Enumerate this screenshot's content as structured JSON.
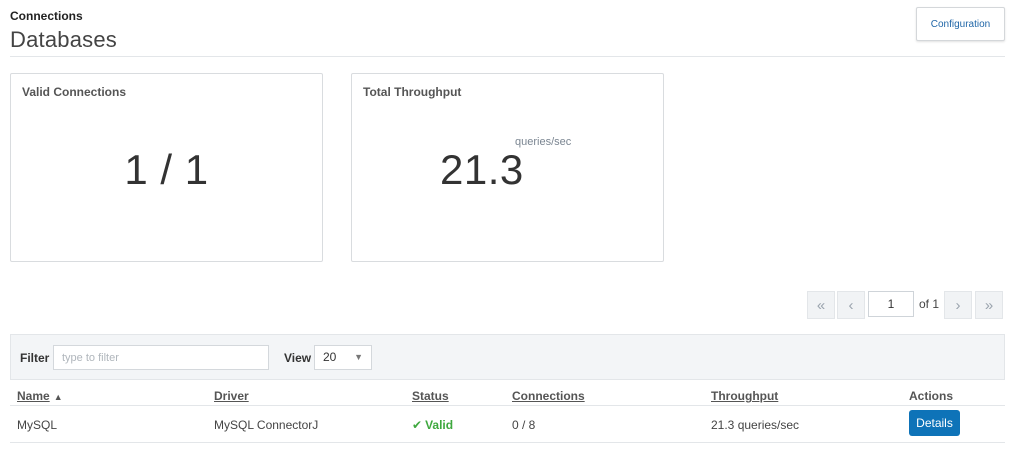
{
  "header": {
    "breadcrumb": "Connections",
    "title": "Databases",
    "config_button": "Configuration"
  },
  "cards": {
    "valid": {
      "title": "Valid Connections",
      "value": "1 / 1"
    },
    "throughput": {
      "title": "Total Throughput",
      "value": "21.3",
      "unit": "queries/sec"
    }
  },
  "pagination": {
    "first": "«",
    "prev": "‹",
    "current_page": "1",
    "of_label": "of 1",
    "next": "›",
    "last": "»"
  },
  "filter": {
    "label": "Filter",
    "placeholder": "type to filter",
    "view_label": "View",
    "view_value": "20"
  },
  "table": {
    "columns": [
      "Name",
      "Driver",
      "Status",
      "Connections",
      "Throughput",
      "Actions"
    ],
    "rows": [
      {
        "name": "MySQL",
        "driver": "MySQL ConnectorJ",
        "status": "Valid",
        "connections": "0 / 8",
        "throughput": "21.3 queries/sec",
        "action": "Details"
      }
    ]
  },
  "colors": {
    "accent": "#0e73b8",
    "valid": "#3ea83e",
    "link": "#2167a8"
  },
  "icons": {
    "sort": "sort-asc-icon",
    "status": "check-icon",
    "select": "chevron-down-icon"
  }
}
